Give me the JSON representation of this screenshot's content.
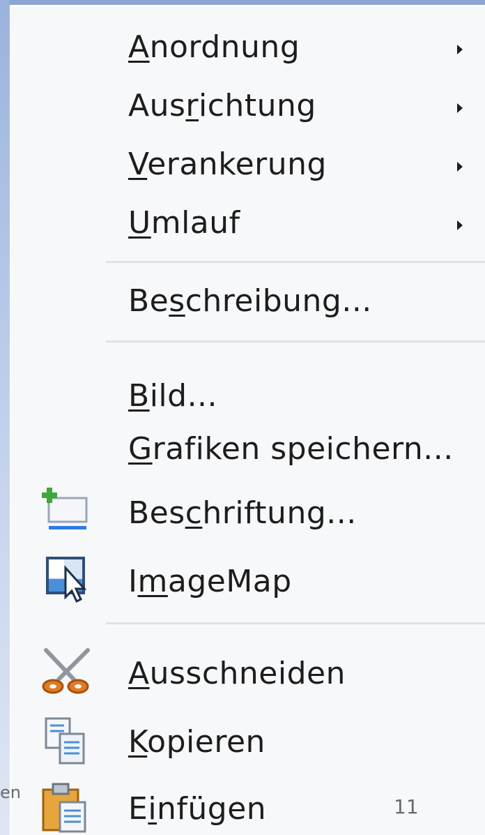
{
  "menu": {
    "items": [
      {
        "pre": "",
        "u": "A",
        "post": "nordnung",
        "submenu": true
      },
      {
        "pre": "Aus",
        "u": "r",
        "post": "ichtung",
        "submenu": true
      },
      {
        "pre": "",
        "u": "V",
        "post": "erankerung",
        "submenu": true
      },
      {
        "pre": "",
        "u": "U",
        "post": "mlauf",
        "submenu": true
      },
      {
        "pre": "Be",
        "u": "s",
        "post": "chreibung...",
        "submenu": false
      },
      {
        "pre": "",
        "u": "B",
        "post": "ild...",
        "submenu": false
      },
      {
        "pre": "",
        "u": "G",
        "post": "rafiken speichern...",
        "submenu": false
      },
      {
        "pre": "Bes",
        "u": "c",
        "post": "hriftung...",
        "submenu": false,
        "icon": "insert-caption-icon"
      },
      {
        "pre": "I",
        "u": "m",
        "post": "ageMap",
        "submenu": false,
        "icon": "imagemap-icon"
      },
      {
        "pre": "",
        "u": "A",
        "post": "usschneiden",
        "submenu": false,
        "icon": "scissors-icon"
      },
      {
        "pre": "",
        "u": "K",
        "post": "opieren",
        "submenu": false,
        "icon": "copy-icon"
      },
      {
        "pre": "E",
        "u": "i",
        "post": "nfügen",
        "submenu": false,
        "icon": "paste-icon"
      }
    ]
  },
  "footer": {
    "left_fragment": "en",
    "page_number": "11"
  },
  "colors": {
    "menu_bg": "#f7f8fa",
    "separator": "#dfe2e7",
    "text": "#1d1d1d",
    "left_strip": "#9ab3dd"
  }
}
